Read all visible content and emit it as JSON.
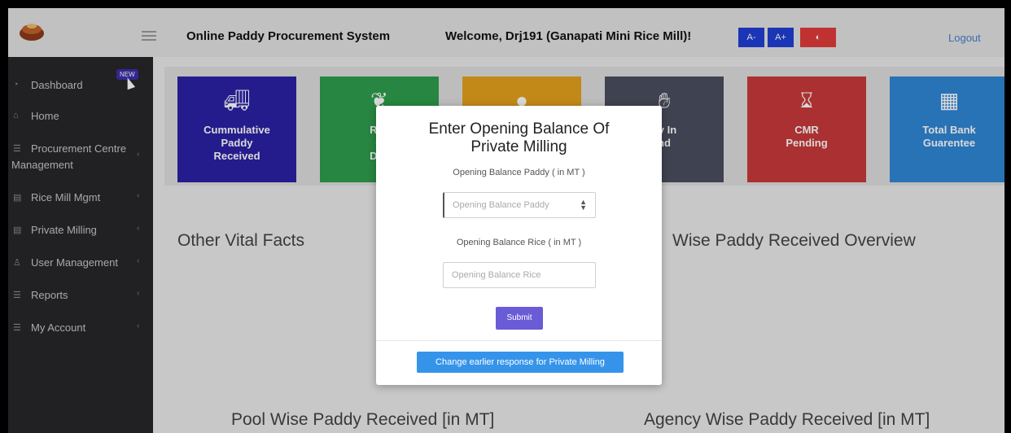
{
  "header": {
    "app_title": "Online Paddy Procurement System",
    "welcome": "Welcome, Drj191 (Ganapati Mini Rice Mill)!",
    "font_decrease": "A-",
    "font_increase": "A+",
    "font_reset_icon": "contrast-icon",
    "logout": "Logout"
  },
  "sidebar": {
    "items": [
      {
        "label": "Dashboard",
        "icon": "dashboard-icon",
        "badge": "NEW"
      },
      {
        "label": "Home",
        "icon": "home-icon"
      },
      {
        "label": "Procurement Centre Management",
        "line1": "Procurement Centre",
        "line2": "Management",
        "icon": "list-icon"
      },
      {
        "label": "Rice Mill Mgmt",
        "icon": "mill-icon"
      },
      {
        "label": "Private Milling",
        "icon": "mill-icon"
      },
      {
        "label": "User Management",
        "icon": "user-icon"
      },
      {
        "label": "Reports",
        "icon": "report-icon"
      },
      {
        "label": "My Account",
        "icon": "account-icon"
      }
    ]
  },
  "cards": [
    {
      "line1": "Cummulative",
      "line2": "Paddy",
      "line3": "Received",
      "icon": "truck-icon",
      "color": "#2b22a6"
    },
    {
      "line1": "Res",
      "line2": "C",
      "line3": "Deli",
      "icon": "plant-icon",
      "color": "#2e9e4d"
    },
    {
      "line1": "",
      "line2": "",
      "line3": "",
      "icon": "person-icon",
      "color": "#e4a21e"
    },
    {
      "line1": "dy In",
      "line2": "nd",
      "line3": "",
      "icon": "hands-icon",
      "color": "#4a4e5e"
    },
    {
      "line1": "CMR",
      "line2": "Pending",
      "line3": "",
      "icon": "hourglass-icon",
      "color": "#c9393a"
    },
    {
      "line1": "Total Bank",
      "line2": "Guarentee",
      "line3": "",
      "icon": "building-icon",
      "color": "#2f86d6"
    }
  ],
  "sections": {
    "other_vital_facts": "Other Vital Facts",
    "wise_paddy_overview": "Wise Paddy Received Overview",
    "pool_wise": "Pool Wise Paddy Received [in MT]",
    "agency_wise": "Agency Wise Paddy Received [in MT]"
  },
  "modal": {
    "title_line1": "Enter Opening Balance Of",
    "title_line2": "Private Milling",
    "paddy_label": "Opening Balance Paddy ( in MT )",
    "paddy_placeholder": "Opening Balance Paddy",
    "rice_label": "Opening Balance Rice ( in MT )",
    "rice_placeholder": "Opening Balance Rice",
    "submit": "Submit",
    "change_response": "Change earlier response for Private Milling"
  }
}
